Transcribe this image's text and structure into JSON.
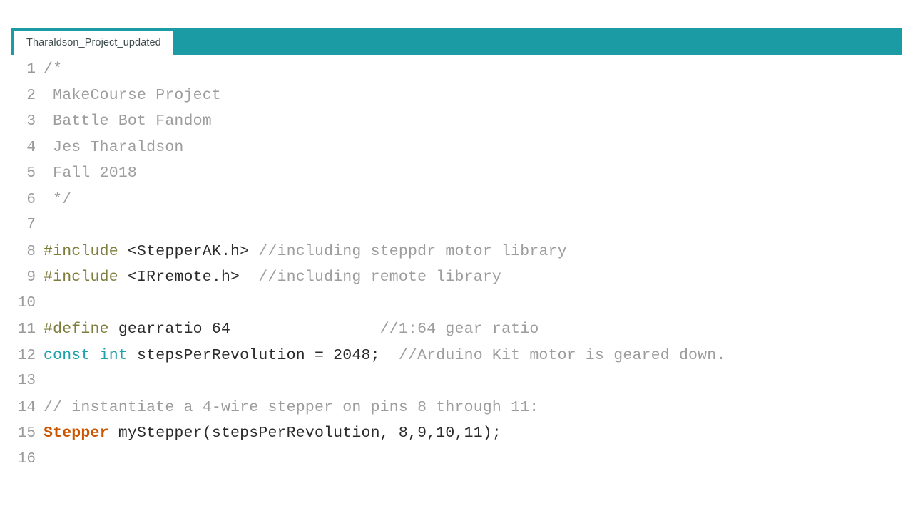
{
  "window": {
    "background_color": "#ffffff",
    "accent_color": "#1b9ba3"
  },
  "tabbar": {
    "accent_color": "#1b9ba3",
    "tabs": [
      {
        "label": "Tharaldson_Project_updated",
        "active": true
      }
    ]
  },
  "editor": {
    "language": "arduino",
    "colors": {
      "comment": "#9d9d9d",
      "preprocessor": "#7e7d3c",
      "keyword": "#1fa0ad",
      "type": "#cc5500",
      "plain": "#2b2b2b",
      "line_number": "#9a9a9a"
    },
    "lines": [
      {
        "number": "1",
        "tokens": [
          {
            "text": "/*",
            "type": "comment"
          }
        ]
      },
      {
        "number": "2",
        "tokens": [
          {
            "text": " MakeCourse Project",
            "type": "comment"
          }
        ]
      },
      {
        "number": "3",
        "tokens": [
          {
            "text": " Battle Bot Fandom",
            "type": "comment"
          }
        ]
      },
      {
        "number": "4",
        "tokens": [
          {
            "text": " Jes Tharaldson",
            "type": "comment"
          }
        ]
      },
      {
        "number": "5",
        "tokens": [
          {
            "text": " Fall 2018",
            "type": "comment"
          }
        ]
      },
      {
        "number": "6",
        "tokens": [
          {
            "text": " */",
            "type": "comment"
          }
        ]
      },
      {
        "number": "7",
        "tokens": [
          {
            "text": "",
            "type": "plain"
          }
        ]
      },
      {
        "number": "8",
        "tokens": [
          {
            "text": "#include",
            "type": "preprocessor"
          },
          {
            "text": " <StepperAK.h> ",
            "type": "plain"
          },
          {
            "text": "//including steppdr motor library",
            "type": "comment"
          }
        ]
      },
      {
        "number": "9",
        "tokens": [
          {
            "text": "#include",
            "type": "preprocessor"
          },
          {
            "text": " <IRremote.h>  ",
            "type": "plain"
          },
          {
            "text": "//including remote library",
            "type": "comment"
          }
        ]
      },
      {
        "number": "10",
        "tokens": [
          {
            "text": "",
            "type": "plain"
          }
        ]
      },
      {
        "number": "11",
        "tokens": [
          {
            "text": "#define",
            "type": "preprocessor"
          },
          {
            "text": " gearratio 64                ",
            "type": "plain"
          },
          {
            "text": "//1:64 gear ratio",
            "type": "comment"
          }
        ]
      },
      {
        "number": "12",
        "tokens": [
          {
            "text": "const int",
            "type": "keyword"
          },
          {
            "text": " stepsPerRevolution = 2048;  ",
            "type": "plain"
          },
          {
            "text": "//Arduino Kit motor is geared down.",
            "type": "comment"
          }
        ]
      },
      {
        "number": "13",
        "tokens": [
          {
            "text": "",
            "type": "plain"
          }
        ]
      },
      {
        "number": "14",
        "tokens": [
          {
            "text": "// instantiate a 4-wire stepper on pins 8 through 11:",
            "type": "comment"
          }
        ]
      },
      {
        "number": "15",
        "tokens": [
          {
            "text": "Stepper",
            "type": "type"
          },
          {
            "text": " myStepper(stepsPerRevolution, 8,9,10,11);",
            "type": "plain"
          }
        ]
      },
      {
        "number": "16",
        "tokens": [
          {
            "text": "",
            "type": "plain"
          }
        ]
      }
    ]
  }
}
